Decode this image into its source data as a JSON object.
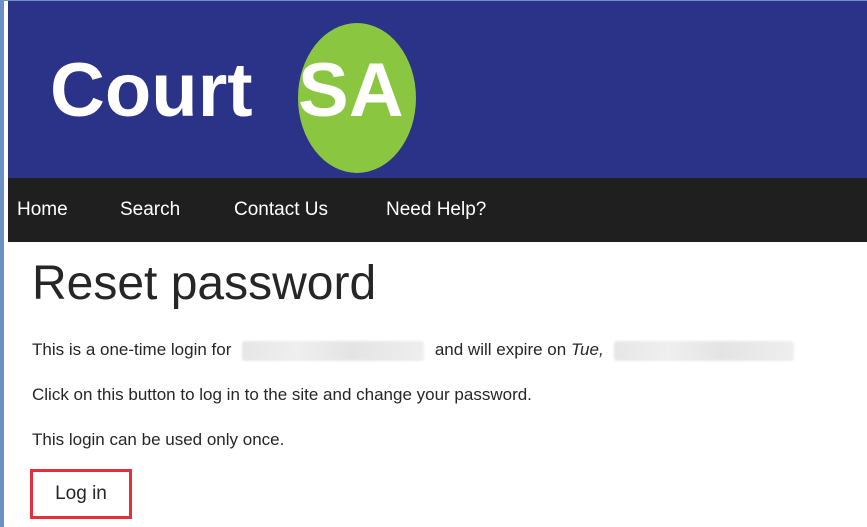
{
  "brand": {
    "name_part1": "Court",
    "name_part2": "SA",
    "header_color": "#2b3389",
    "logo_circle_color": "#8bc641"
  },
  "nav": {
    "items": [
      {
        "label": "Home"
      },
      {
        "label": "Search"
      },
      {
        "label": "Contact Us"
      },
      {
        "label": "Need Help?"
      }
    ],
    "background_color": "#1f1f1f"
  },
  "main": {
    "title": "Reset password",
    "line1_prefix": "This is a one-time login for",
    "line1_middle": "and will expire on",
    "line1_day": "Tue,",
    "line2": "Click on this button to log in to the site and change your password.",
    "line3": "This login can be used only once.",
    "login_button_label": "Log in",
    "highlight_color": "#e2313a"
  }
}
